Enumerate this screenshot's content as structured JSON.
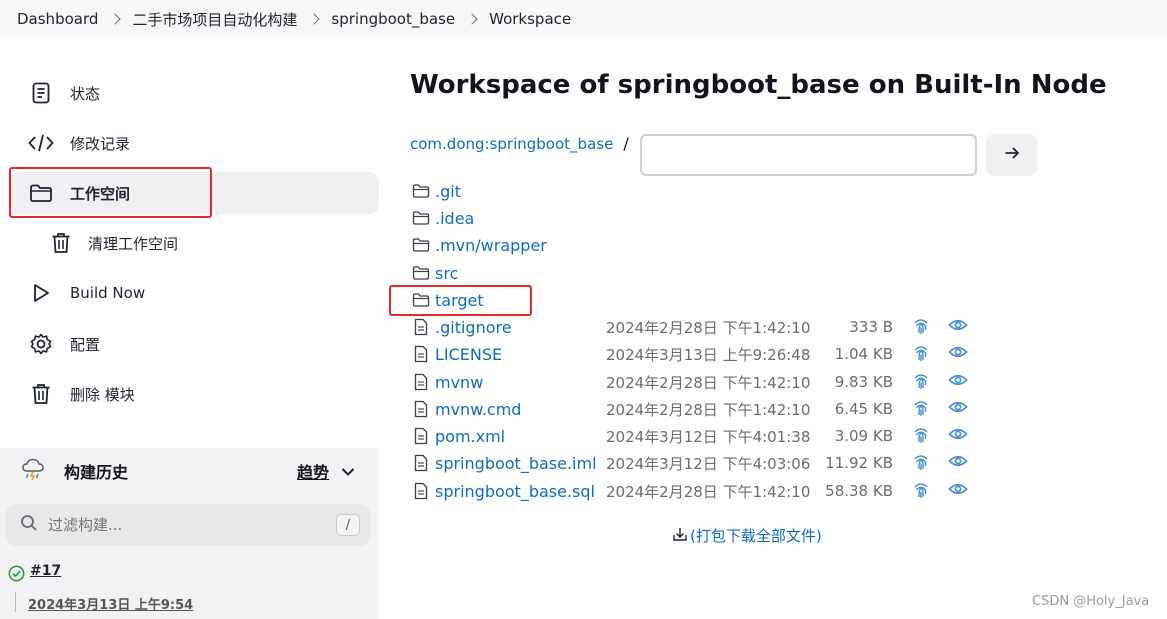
{
  "breadcrumb": [
    "Dashboard",
    "二手市场项目自动化构建",
    "springboot_base",
    "Workspace"
  ],
  "sidebar": {
    "items": [
      {
        "label": "状态",
        "icon": "document-icon"
      },
      {
        "label": "修改记录",
        "icon": "code-icon"
      },
      {
        "label": "工作空间",
        "icon": "folder-icon",
        "active": true
      },
      {
        "label": "清理工作空间",
        "icon": "trash-icon"
      },
      {
        "label": "Build Now",
        "icon": "play-icon"
      },
      {
        "label": "配置",
        "icon": "gear-icon"
      },
      {
        "label": "删除 模块",
        "icon": "trash-icon"
      }
    ],
    "history_title": "构建历史",
    "trend_label": "趋势",
    "filter_placeholder": "过滤构建...",
    "filter_shortcut": "/",
    "build": {
      "number": "#17",
      "date": "2024年3月13日 上午9:54"
    }
  },
  "main": {
    "title": "Workspace of springboot_base on Built-In Node",
    "path_root": "com.dong:springboot_base",
    "path_sep": "/",
    "path_value": "",
    "folders": [
      ".git",
      ".idea",
      ".mvn/wrapper",
      "src",
      "target"
    ],
    "files": [
      {
        "name": ".gitignore",
        "date": "2024年2月28日 下午1:42:10",
        "size": "333 B"
      },
      {
        "name": "LICENSE",
        "date": "2024年3月13日 上午9:26:48",
        "size": "1.04 KB"
      },
      {
        "name": "mvnw",
        "date": "2024年2月28日 下午1:42:10",
        "size": "9.83 KB"
      },
      {
        "name": "mvnw.cmd",
        "date": "2024年2月28日 下午1:42:10",
        "size": "6.45 KB"
      },
      {
        "name": "pom.xml",
        "date": "2024年3月12日 下午4:01:38",
        "size": "3.09 KB"
      },
      {
        "name": "springboot_base.iml",
        "date": "2024年3月12日 下午4:03:06",
        "size": "11.92 KB"
      },
      {
        "name": "springboot_base.sql",
        "date": "2024年2月28日 下午1:42:10",
        "size": "58.38 KB"
      }
    ],
    "zip_label": "(打包下载全部文件)"
  },
  "watermark": "CSDN @Holy_Java",
  "colors": {
    "link": "#0b6bcb",
    "highlight": "#e52a2a",
    "success": "#1ea446"
  }
}
